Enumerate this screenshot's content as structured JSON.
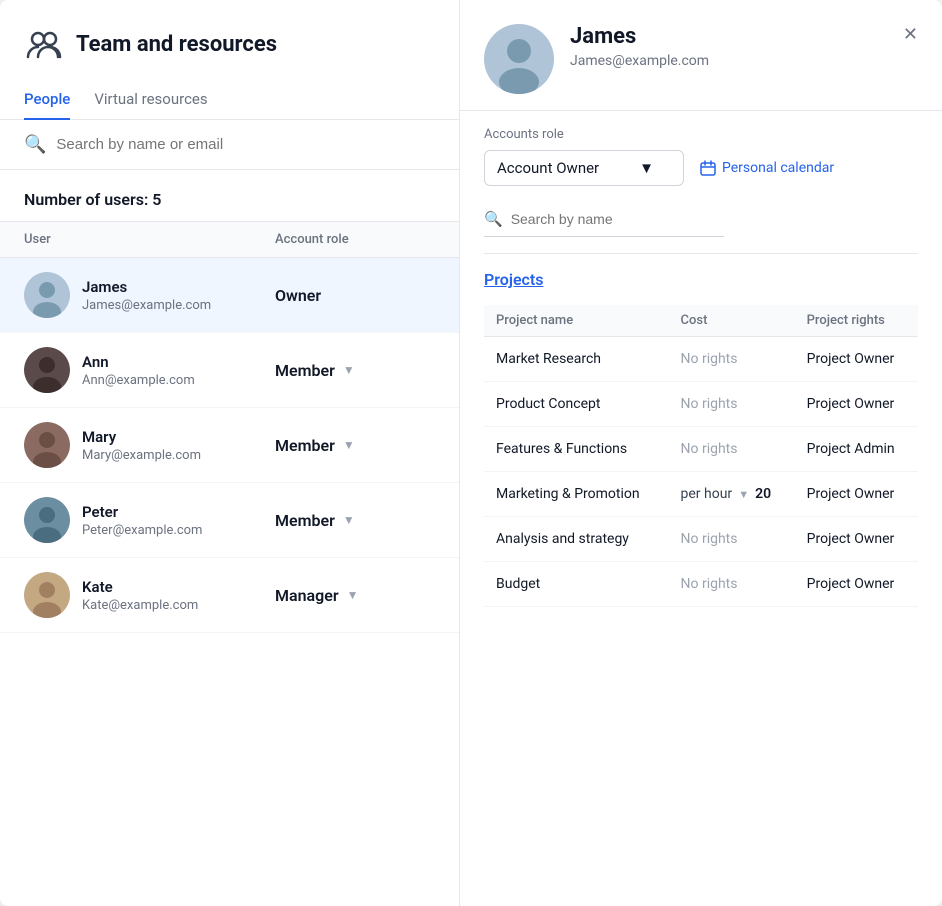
{
  "page": {
    "title": "Team and resources",
    "tabs": [
      "People",
      "Virtual resources"
    ],
    "active_tab": "People",
    "search_placeholder": "Search by name or email",
    "user_count_label": "Number of users: 5",
    "table_headers": {
      "user": "User",
      "role": "Account role"
    }
  },
  "users": [
    {
      "id": 1,
      "name": "James",
      "email": "James@example.com",
      "role": "Owner",
      "has_dropdown": false,
      "selected": true,
      "color": "#b0c4d8"
    },
    {
      "id": 2,
      "name": "Ann",
      "email": "Ann@example.com",
      "role": "Member",
      "has_dropdown": true,
      "selected": false,
      "color": "#5a4a4a"
    },
    {
      "id": 3,
      "name": "Mary",
      "email": "Mary@example.com",
      "role": "Member",
      "has_dropdown": true,
      "selected": false,
      "color": "#8b6b61"
    },
    {
      "id": 4,
      "name": "Peter",
      "email": "Peter@example.com",
      "role": "Member",
      "has_dropdown": true,
      "selected": false,
      "color": "#6b8fa0"
    },
    {
      "id": 5,
      "name": "Kate",
      "email": "Kate@example.com",
      "role": "Manager",
      "has_dropdown": true,
      "selected": false,
      "color": "#c4a882"
    }
  ],
  "detail": {
    "name": "James",
    "email": "James@example.com",
    "accounts_role_label": "Accounts role",
    "account_owner_label": "Account Owner",
    "personal_calendar_label": "Personal calendar",
    "search_placeholder": "Search by name",
    "projects_title": "Projects",
    "projects_table_headers": {
      "name": "Project name",
      "cost": "Cost",
      "rights": "Project rights"
    },
    "projects": [
      {
        "name": "Market Research",
        "cost": "No rights",
        "cost_type": "no_rights",
        "rights": "Project Owner"
      },
      {
        "name": "Product Concept",
        "cost": "No rights",
        "cost_type": "no_rights",
        "rights": "Project Owner"
      },
      {
        "name": "Features & Functions",
        "cost": "No rights",
        "cost_type": "no_rights",
        "rights": "Project Admin"
      },
      {
        "name": "Marketing & Promotion",
        "cost": "per hour",
        "cost_amount": "20",
        "cost_type": "per_hour",
        "rights": "Project Owner"
      },
      {
        "name": "Analysis and strategy",
        "cost": "No rights",
        "cost_type": "no_rights",
        "rights": "Project Owner"
      },
      {
        "name": "Budget",
        "cost": "No rights",
        "cost_type": "no_rights",
        "rights": "Project Owner"
      }
    ]
  }
}
